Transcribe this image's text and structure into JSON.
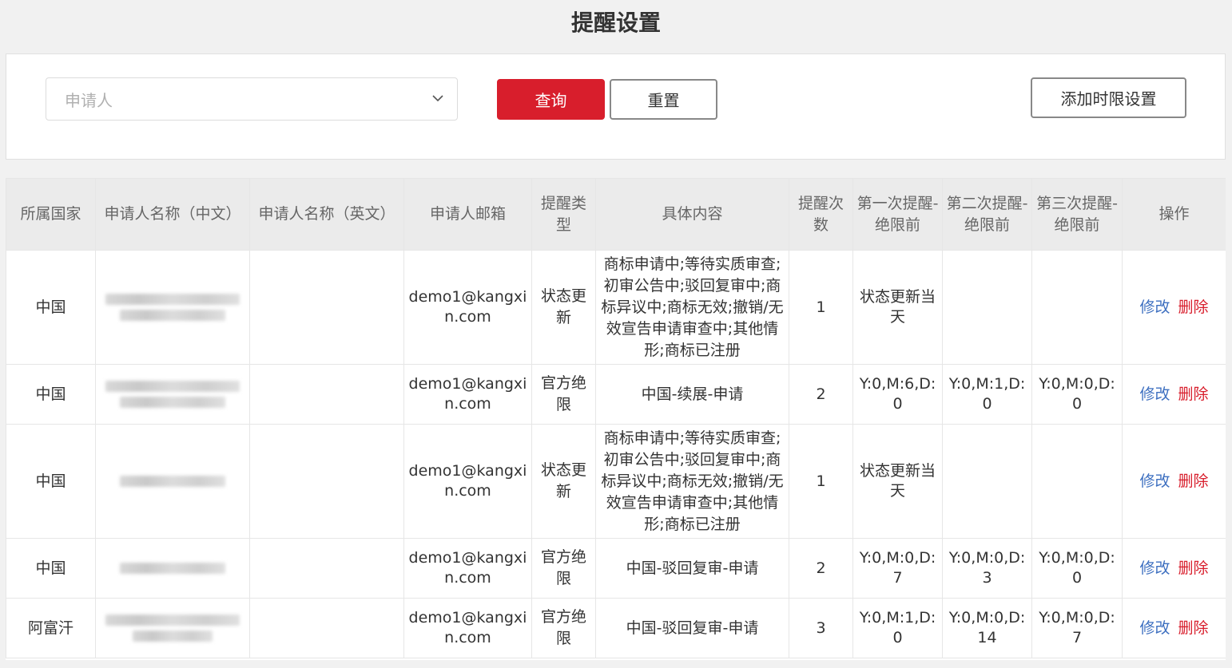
{
  "page": {
    "title": "提醒设置"
  },
  "filter": {
    "applicant_placeholder": "申请人",
    "query_label": "查询",
    "reset_label": "重置",
    "add_label": "添加时限设置"
  },
  "table": {
    "headers": [
      "所属国家",
      "申请人名称（中文）",
      "申请人名称（英文）",
      "申请人邮箱",
      "提醒类型",
      "具体内容",
      "提醒次数",
      "第一次提醒-绝限前",
      "第二次提醒-绝限前",
      "第三次提醒-绝限前",
      "操作"
    ],
    "edit_label": "修改",
    "delete_label": "删除",
    "rows": [
      {
        "country": "中国",
        "name_en": "",
        "email": "demo1@kangxin.com",
        "type": "状态更新",
        "content": "商标申请中;等待实质审查;初审公告中;驳回复审中;商标异议中;商标无效;撤销/无效宣告申请审查中;其他情形;商标已注册",
        "count": "1",
        "first": "状态更新当天",
        "second": "",
        "third": ""
      },
      {
        "country": "中国",
        "name_en": "",
        "email": "demo1@kangxin.com",
        "type": "官方绝限",
        "content": "中国-续展-申请",
        "count": "2",
        "first": "Y:0,M:6,D:0",
        "second": "Y:0,M:1,D:0",
        "third": "Y:0,M:0,D:0"
      },
      {
        "country": "中国",
        "name_en": "",
        "email": "demo1@kangxin.com",
        "type": "状态更新",
        "content": "商标申请中;等待实质审查;初审公告中;驳回复审中;商标异议中;商标无效;撤销/无效宣告申请审查中;其他情形;商标已注册",
        "count": "1",
        "first": "状态更新当天",
        "second": "",
        "third": ""
      },
      {
        "country": "中国",
        "name_en": "",
        "email": "demo1@kangxin.com",
        "type": "官方绝限",
        "content": "中国-驳回复审-申请",
        "count": "2",
        "first": "Y:0,M:0,D:7",
        "second": "Y:0,M:0,D:3",
        "third": "Y:0,M:0,D:0"
      },
      {
        "country": "阿富汗",
        "name_en": "",
        "email": "demo1@kangxin.com",
        "type": "官方绝限",
        "content": "中国-驳回复审-申请",
        "count": "3",
        "first": "Y:0,M:1,D:0",
        "second": "Y:0,M:0,D:14",
        "third": "Y:0,M:0,D:7"
      }
    ]
  }
}
